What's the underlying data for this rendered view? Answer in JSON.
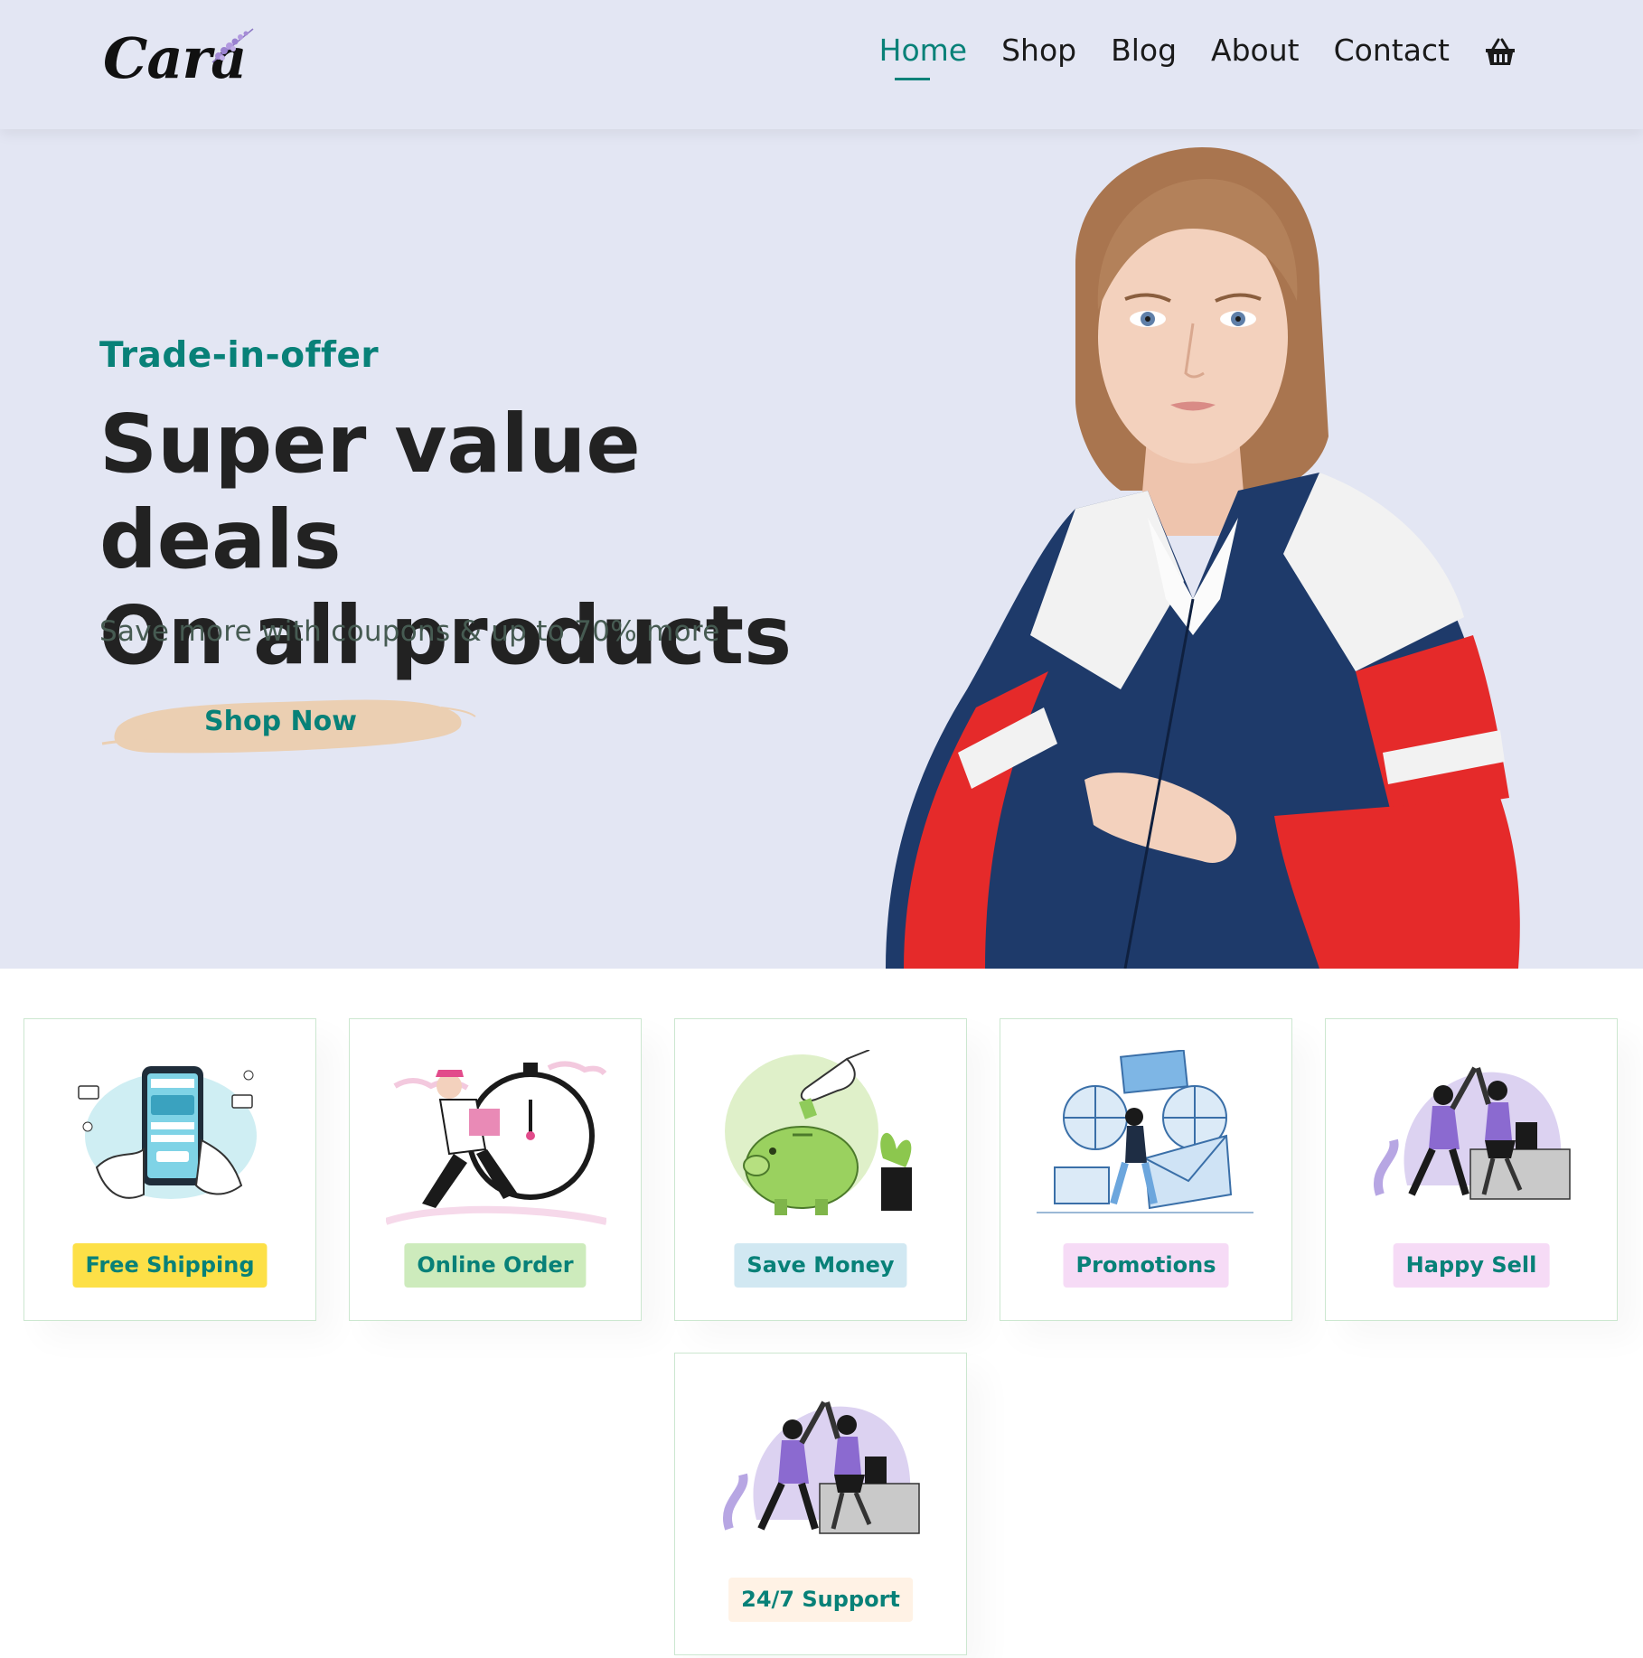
{
  "header": {
    "logo_text": "Cara",
    "nav": [
      {
        "label": "Home",
        "active": true
      },
      {
        "label": "Shop",
        "active": false
      },
      {
        "label": "Blog",
        "active": false
      },
      {
        "label": "About",
        "active": false
      },
      {
        "label": "Contact",
        "active": false
      }
    ],
    "cart_icon": "shopping-basket-icon"
  },
  "hero": {
    "subtitle": "Trade-in-offer",
    "title_line1": "Super value deals",
    "title_line2": "On all products",
    "description": "Save more with coupons & up to 70% more",
    "button_label": "Shop Now",
    "button_color": "#ebcfb2"
  },
  "features": [
    {
      "label": "Free Shipping",
      "bg": "#fddde4",
      "label_bg": "#fde047"
    },
    {
      "label": "Online Order",
      "label_bg": "#cdebbc"
    },
    {
      "label": "Save Money",
      "label_bg": "#d1e8f2"
    },
    {
      "label": "Promotions",
      "label_bg": "#f6dbf6"
    },
    {
      "label": "Happy Sell",
      "label_bg": "#f6dbf6"
    },
    {
      "label": "24/7 Support",
      "label_bg": "#fff2e5"
    }
  ],
  "colors": {
    "accent": "#088178",
    "hero_bg": "#e3e6f3",
    "text_dark": "#222222"
  }
}
